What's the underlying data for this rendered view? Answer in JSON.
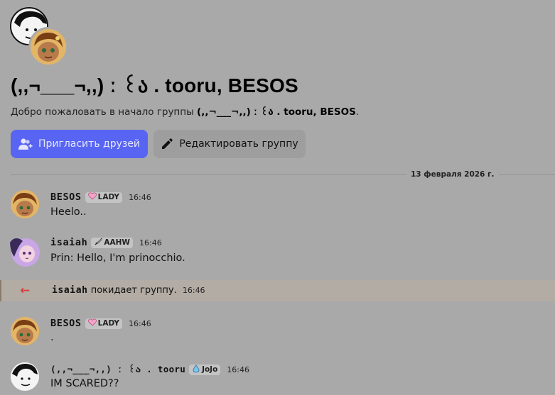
{
  "group": {
    "name": "(,,¬___¬,,)  ː  ꒰ა . tooru, BESOS",
    "welcome_prefix": "Добро пожаловать в начало группы ",
    "welcome_name": "(,,¬___¬,,)  ː  ꒰ა . tooru, BESOS",
    "welcome_suffix": ".",
    "invite_label": "Пригласить друзей",
    "edit_label": "Редактировать группу"
  },
  "date_divider": "13 февраля 2026 г.",
  "messages": [
    {
      "author": "BESOS",
      "tag_icon": "heart-icon",
      "tag": "LADY",
      "time": "16:46",
      "text": "Heelo.."
    },
    {
      "author": "isaiah",
      "tag_icon": "sword-icon",
      "tag": "AAHW",
      "time": "16:46",
      "text": "Prin: Hello, I'm prinocchio."
    },
    {
      "author": "BESOS",
      "tag_icon": "heart-icon",
      "tag": "LADY",
      "time": "16:46",
      "text": "."
    },
    {
      "author": "(,,¬___¬,,)  ː  ꒰ა . tooru",
      "tag_icon": "water-drop-icon",
      "tag": "JoJo",
      "time": "16:46",
      "text": "IM SCARED??"
    }
  ],
  "system": {
    "icon": "leave-arrow-icon",
    "arrow": "←",
    "name": "isaiah",
    "text": " покидает группу.",
    "time": "16:46"
  },
  "colors": {
    "background": "#a9a9a9",
    "accent": "#5865f2",
    "leave_arrow": "#d94040"
  }
}
